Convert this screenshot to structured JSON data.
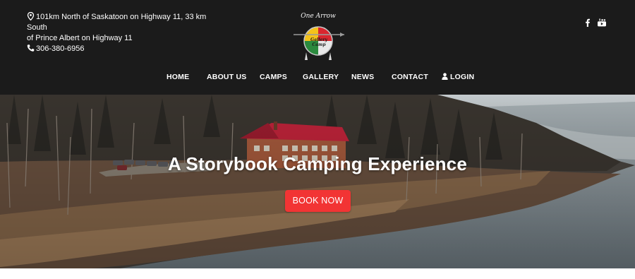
{
  "header": {
    "address_line1": "101km North of Saskatoon on Highway 11, 33 km South",
    "address_line2": "of Prince Albert on Highway 11",
    "phone": "306-380-6956",
    "logo": {
      "text_top": "One Arrow",
      "text_middle": "Gallery Camp",
      "alt": "One Arrow logo"
    },
    "social": [
      {
        "name": "facebook-icon"
      },
      {
        "name": "youtube-icon"
      }
    ]
  },
  "nav": {
    "items": [
      {
        "label": "HOME"
      },
      {
        "label": "ABOUT US"
      },
      {
        "label": "CAMPS"
      },
      {
        "label": "GALLERY"
      },
      {
        "label": "NEWS"
      },
      {
        "label": "CONTACT"
      },
      {
        "label": "LOGIN",
        "icon": "user-icon"
      }
    ]
  },
  "hero": {
    "title": "A Storybook Camping Experience",
    "button_label": "BOOK NOW"
  },
  "colors": {
    "topbar_bg": "#1b1b1b",
    "button_bg": "#f23434",
    "roof_red": "#c0233a",
    "water": "#8b959a"
  }
}
